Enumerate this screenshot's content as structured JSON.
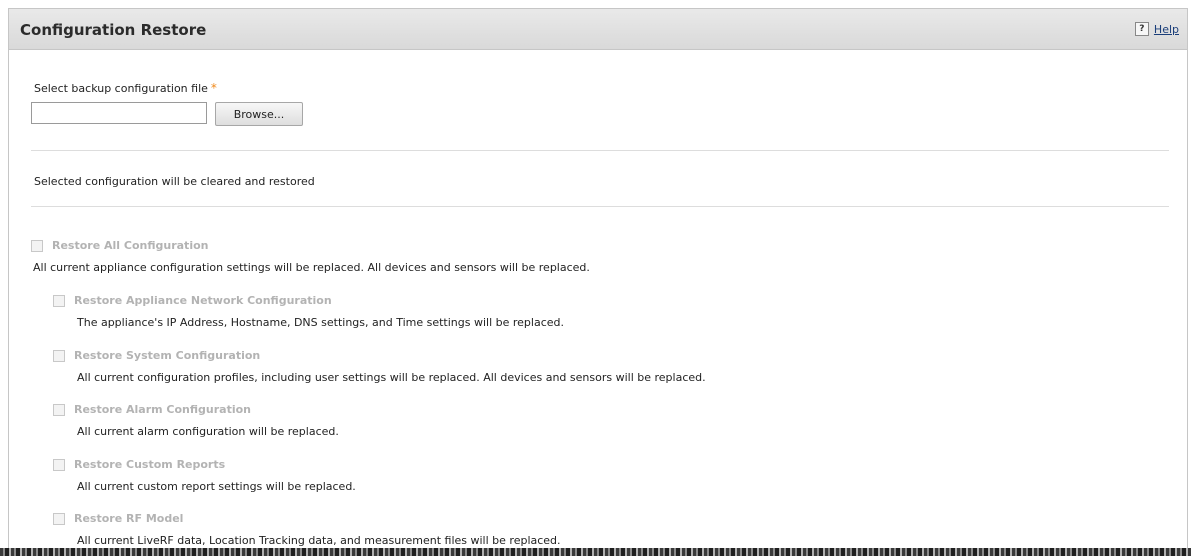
{
  "panel": {
    "title": "Configuration Restore",
    "help_label": "Help",
    "help_icon_glyph": "?"
  },
  "file": {
    "label": "Select backup configuration file",
    "required_marker": "*",
    "value": "",
    "placeholder": "",
    "browse_label": "Browse..."
  },
  "notice": "Selected configuration will be cleared and restored",
  "options": [
    {
      "label": "Restore All Configuration",
      "description": "All current appliance configuration settings will be replaced. All devices and sensors will be replaced.",
      "checked": false,
      "enabled": false
    },
    {
      "label": "Restore Appliance Network Configuration",
      "description": "The appliance's IP Address, Hostname, DNS settings, and Time settings will be replaced.",
      "checked": false,
      "enabled": false
    },
    {
      "label": "Restore System Configuration",
      "description": "All current configuration profiles, including user settings will be replaced. All devices and sensors will be replaced.",
      "checked": false,
      "enabled": false
    },
    {
      "label": "Restore Alarm Configuration",
      "description": "All current alarm configuration will be replaced.",
      "checked": false,
      "enabled": false
    },
    {
      "label": "Restore Custom Reports",
      "description": "All current custom report settings will be replaced.",
      "checked": false,
      "enabled": false
    },
    {
      "label": "Restore RF Model",
      "description": "All current LiveRF data, Location Tracking data, and measurement files will be replaced.",
      "checked": false,
      "enabled": false
    }
  ],
  "colors": {
    "header_bg": "#dedede",
    "disabled_label": "#b3b3b3",
    "required_star": "#f08a1c",
    "help_link": "#1a3e7a"
  }
}
